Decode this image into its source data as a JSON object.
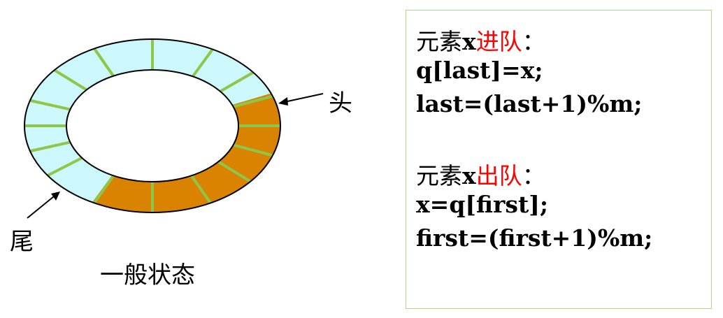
{
  "diagram": {
    "head_label": "头",
    "tail_label": "尾",
    "caption": "一般状态",
    "colors": {
      "empty": "#ccf7fb",
      "occupied": "#d98300",
      "divider": "#8fc64a",
      "outline": "#000000"
    }
  },
  "code": {
    "enqueue_title_prefix": "元素",
    "enqueue_title_var": "x",
    "enqueue_title_action": "进队",
    "enqueue_title_colon": "：",
    "enqueue_line1": "q[last]=x;",
    "enqueue_line2": "last=(last+1)%m;",
    "dequeue_title_prefix": "元素",
    "dequeue_title_var": "x",
    "dequeue_title_action": "出队",
    "dequeue_title_colon": "：",
    "dequeue_line1": "x=q[first];",
    "dequeue_line2": "first=(first+1)%m;"
  }
}
